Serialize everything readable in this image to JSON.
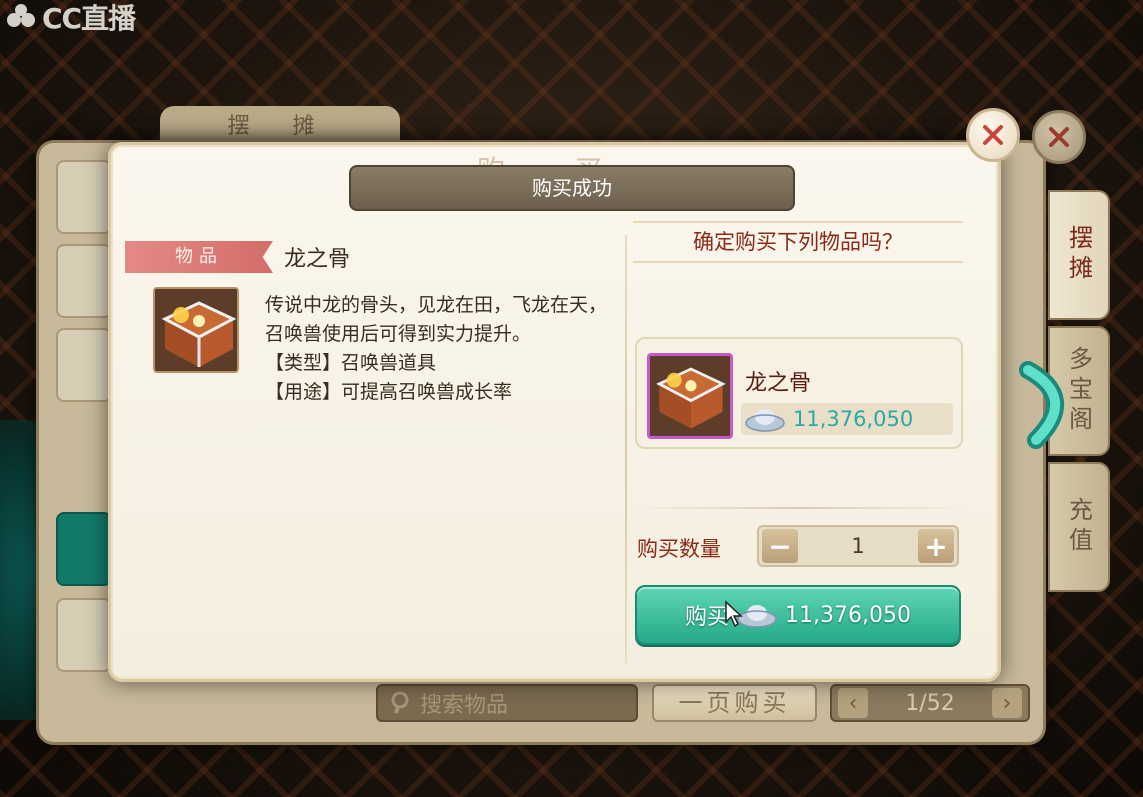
{
  "watermark": {
    "text": "CC直播"
  },
  "stall": {
    "tab_label": "摆 摊",
    "right_tabs": [
      "摆摊",
      "多宝阁",
      "充值"
    ],
    "search_placeholder": "搜索物品",
    "buy_page_label": "一页购买",
    "page_indicator": "1/52"
  },
  "dialog": {
    "ghost_title": "购 买",
    "toast": "购买成功",
    "item_tag": "物品",
    "item_name": "龙之骨",
    "description": "传说中龙的骨头，见龙在田，飞龙在天，召唤兽使用后可得到实力提升。",
    "type_line": "【类型】召唤兽道具",
    "usage_line": "【用途】可提高召唤兽成长率",
    "confirm_prompt": "确定购买下列物品吗？",
    "cart_item_name": "龙之骨",
    "cart_item_price": "11,376,050",
    "quantity_label": "购买数量",
    "quantity_value": "1",
    "buy_button_label": "购买",
    "buy_button_price": "11,376,050"
  },
  "colors": {
    "accent_teal": "#25a988",
    "price_teal": "#2aa9a0",
    "prompt_red": "#8a2b18"
  },
  "icons": [
    "cc-logo-icon",
    "close-icon",
    "next-arrow-icon",
    "search-icon",
    "silver-ingot-icon",
    "treasure-chest-icon",
    "minus-icon",
    "plus-icon",
    "mouse-cursor-icon"
  ]
}
